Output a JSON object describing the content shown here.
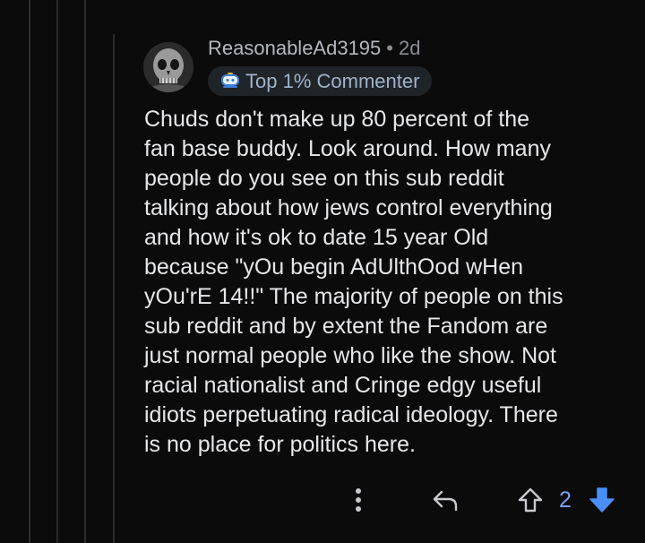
{
  "comment": {
    "username": "ReasonableAd3195",
    "separator": "•",
    "time": "2d",
    "badge": "Top 1% Commenter",
    "body": "Chuds don't make up 80 percent of the\nfan base buddy. Look around. How many\npeople do you see on this sub reddit\ntalking about how jews control everything\nand how it's ok to date 15 year Old\nbecause \"yOu begin AdUlthOod wHen\nyOu'rE 14!!\" The majority of people on this\nsub reddit and by extent the Fandom are\njust normal people who like the show. Not\nracial nationalist and Cringe edgy useful\nidiots perpetuating radical ideology. There\nis no place for politics here."
  },
  "actions": {
    "vote_count": "2",
    "icons": [
      "more-options-icon",
      "reply-icon",
      "upvote-icon",
      "downvote-icon"
    ]
  },
  "colors": {
    "background": "#0b0b0c",
    "text": "#e6e7e9",
    "username": "#b4b8bd",
    "badge_bg": "#1f2429",
    "downvote_accent": "#4a8ff7",
    "vote_count": "#7da2f0"
  }
}
